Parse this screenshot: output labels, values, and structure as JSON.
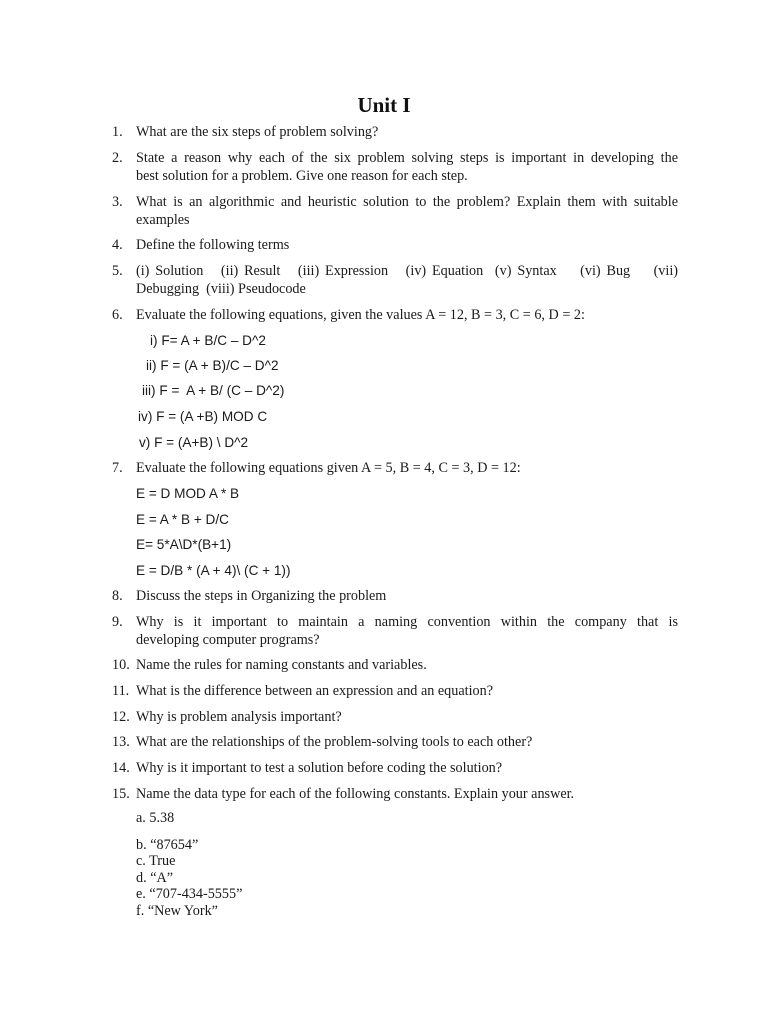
{
  "title": "Unit I",
  "questions": [
    {
      "num": "1.",
      "text": "What are the six steps of problem solving?"
    },
    {
      "num": "2.",
      "line1": "State a reason why each of the six problem solving steps is important in developing the",
      "line2": "best solution for a problem. Give one reason for each step."
    },
    {
      "num": "3.",
      "line1": "What is an algorithmic and heuristic solution to the problem? Explain them with suitable",
      "line2": "examples"
    },
    {
      "num": "4.",
      "text": "Define the following terms"
    },
    {
      "num": "5.",
      "line1": "(i) Solution   (ii) Result   (iii) Expression   (iv) Equation  (v) Syntax    (vi) Bug    (vii)",
      "line2": "Debugging  (viii) Pseudocode"
    },
    {
      "num": "6.",
      "text": "Evaluate the following equations, given the values A = 12, B = 3, C = 6, D = 2:"
    },
    {
      "num": "7.",
      "text": "Evaluate the following equations given A = 5, B = 4, C = 3, D = 12:"
    },
    {
      "num": "8.",
      "text": "Discuss the steps in Organizing the problem"
    },
    {
      "num": "9.",
      "line1": "Why is it important to maintain a naming convention within the company that is",
      "line2": "developing computer programs?"
    },
    {
      "num": "10.",
      "text": "Name the rules for naming constants and variables."
    },
    {
      "num": "11.",
      "text": "What is the difference between an expression and an equation?"
    },
    {
      "num": "12.",
      "text": "Why is problem analysis important?"
    },
    {
      "num": "13.",
      "text": "What are the relationships of the problem-solving tools to each other?"
    },
    {
      "num": "14.",
      "text": "Why is it important to test a solution before coding the solution?"
    },
    {
      "num": "15.",
      "text": "Name the data type for each of the following constants. Explain your answer."
    }
  ],
  "q6_equations": [
    "i) F= A + B/C – D^2",
    "ii) F = (A + B)/C – D^2",
    "iii) F =  A + B/ (C – D^2)",
    "iv) F = (A +B) MOD C",
    "v) F = (A+B) \\ D^2"
  ],
  "q7_equations": [
    "E = D MOD A * B",
    "E = A * B + D/C",
    "E= 5*A\\D*(B+1)",
    "E = D/B * (A + 4)\\ (C + 1))"
  ],
  "q15_options": [
    "a. 5.38",
    "b. “87654”",
    "c. True",
    "d. “A”",
    "e. “707-434-5555”",
    "f. “New York”"
  ]
}
